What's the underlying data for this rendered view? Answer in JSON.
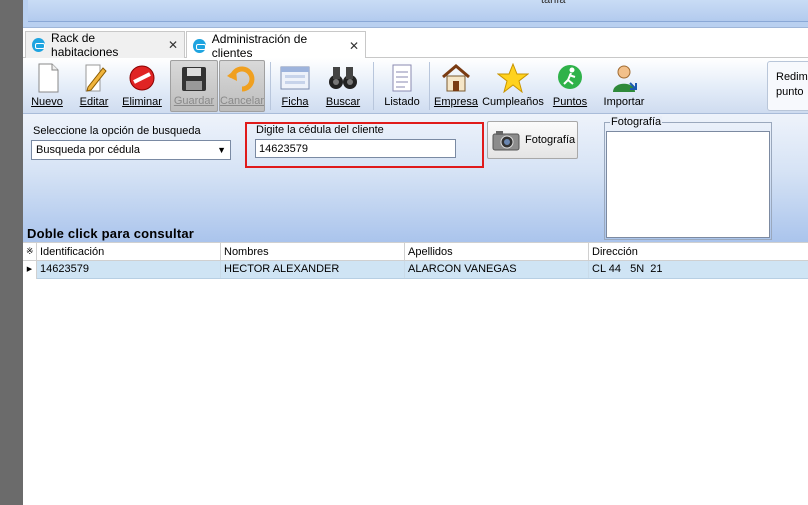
{
  "window": {
    "banner_text": "tarifa"
  },
  "tabs": [
    {
      "label": "Rack de habitaciones",
      "close": "✕"
    },
    {
      "label": "Administración de clientes",
      "close": "✕"
    }
  ],
  "toolbar": {
    "buttons": [
      {
        "label": "Nuevo",
        "icon": "new-document-icon"
      },
      {
        "label": "Editar",
        "icon": "pencil-edit-icon"
      },
      {
        "label": "Eliminar",
        "icon": "delete-no-icon"
      },
      {
        "label": "Guardar",
        "icon": "floppy-save-icon",
        "disabled": true
      },
      {
        "label": "Cancelar",
        "icon": "undo-cancel-icon",
        "disabled": true
      },
      {
        "label": "Ficha",
        "icon": "form-card-icon"
      },
      {
        "label": "Buscar",
        "icon": "binoculars-search-icon"
      },
      {
        "label": "Listado",
        "icon": "list-document-icon"
      },
      {
        "label": "Empresa",
        "icon": "house-company-icon"
      },
      {
        "label": "Cumpleaños",
        "icon": "star-birthday-icon"
      },
      {
        "label": "Puntos",
        "icon": "runner-points-icon"
      },
      {
        "label": "Importar",
        "icon": "person-import-icon"
      }
    ],
    "right_button": {
      "line1": "Redim",
      "line2": "punto"
    }
  },
  "search": {
    "option_label": "Seleccione la opción de busqueda",
    "option_value": "Busqueda por cédula",
    "cedula_label": "Digite la cédula del cliente",
    "cedula_value": "14623579",
    "photo_button": "Fotografía",
    "photo_group_label": "Fotografía"
  },
  "grid": {
    "title": "Doble click para consultar",
    "columns": [
      "Identificación",
      "Nombres",
      "Apellidos",
      "Dirección"
    ],
    "rows": [
      [
        "14623579",
        "HECTOR ALEXANDER",
        "ALARCON VANEGAS",
        "CL 44   5N  21"
      ]
    ]
  },
  "colors": {
    "accent": "#1ea4e0",
    "highlight_border": "#e01b1b",
    "row_selected": "#cfe4f4"
  }
}
